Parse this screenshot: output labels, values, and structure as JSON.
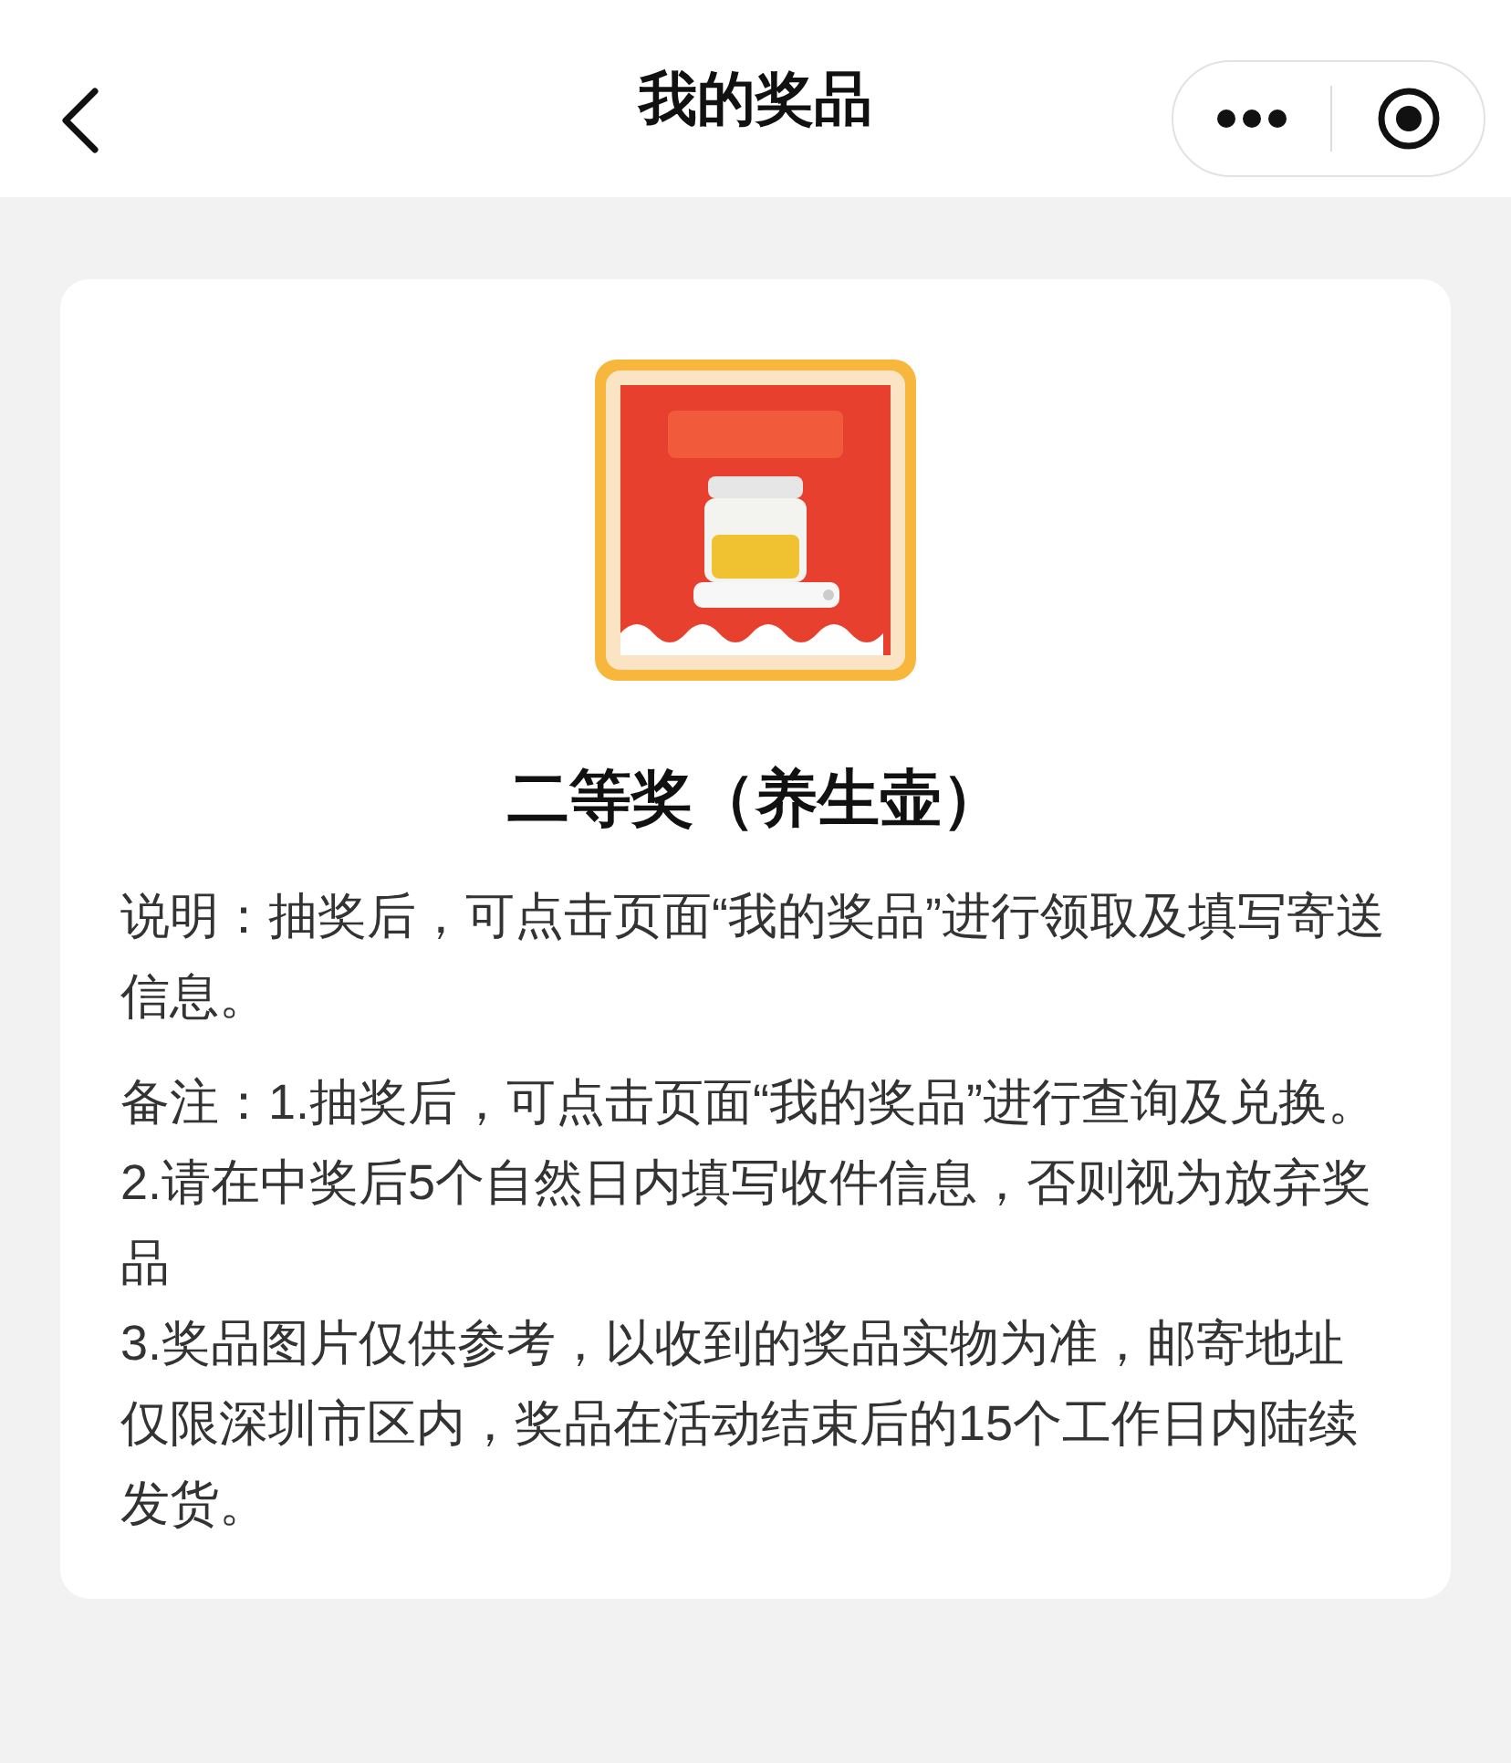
{
  "nav": {
    "title": "我的奖品"
  },
  "prize": {
    "title": "二等奖（养生壶）"
  },
  "description": "说明：抽奖后，可点击页面“我的奖品”进行领取及填写寄送信息。",
  "notes": [
    "备注：1.抽奖后，可点击页面“我的奖品”进行查询及兑换。",
    "2.请在中奖后5个自然日内填写收件信息，否则视为放弃奖品",
    "3.奖品图片仅供参考，以收到的奖品实物为准，邮寄地址仅限深圳市区内，奖品在活动结束后的15个工作日内陆续发货。"
  ]
}
